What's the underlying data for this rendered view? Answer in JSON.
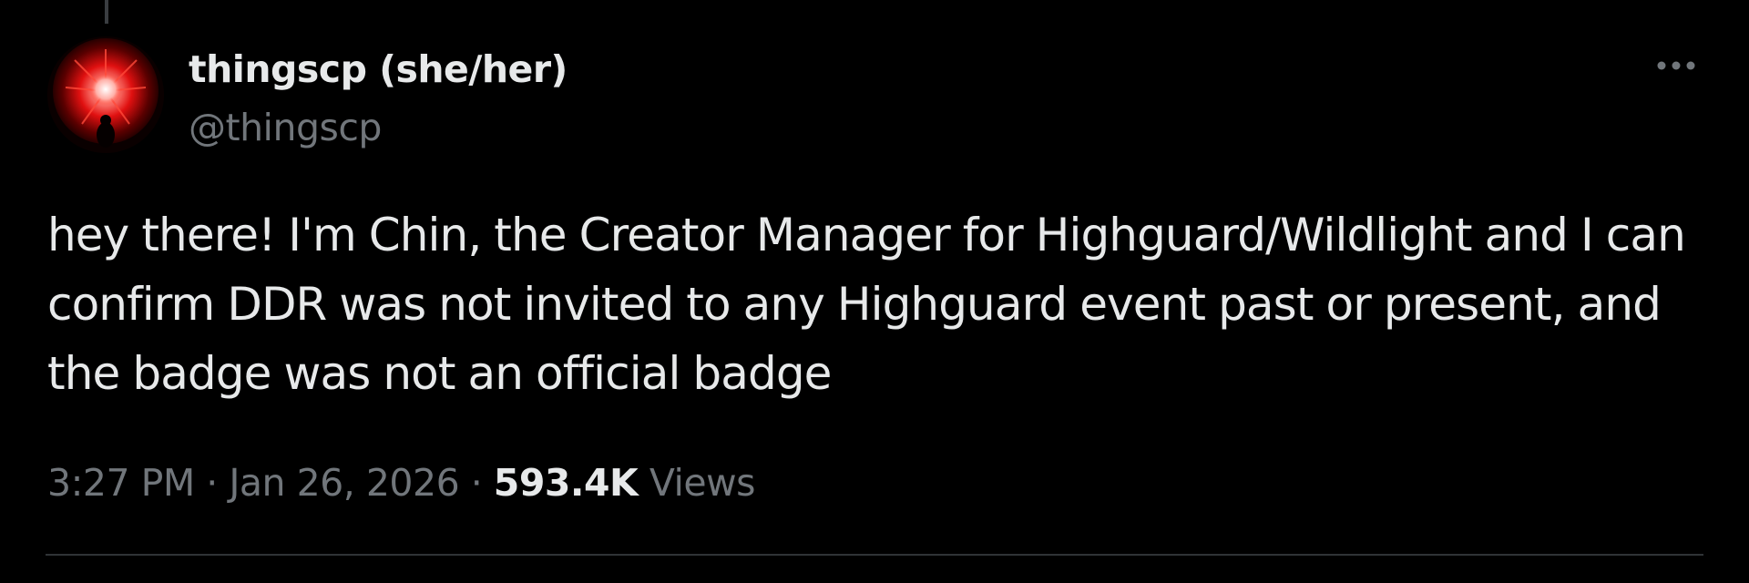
{
  "author": {
    "display_name": "thingscp (she/her)",
    "handle": "@thingscp",
    "avatar_icon": "red-burst-avatar"
  },
  "post": {
    "text_lines": [
      "hey there! I'm Chin, the Creator Manager for Highguard/Wildlight and I can",
      "confirm DDR was not invited to any Highguard event past or present, and",
      "the badge was not an official badge"
    ],
    "time": "3:27 PM",
    "separator": "·",
    "date": "Jan 26, 2026",
    "views_count": "593.4K",
    "views_label": "Views"
  },
  "menu": {
    "more_icon": "more-horizontal-icon"
  },
  "colors": {
    "background": "#000000",
    "primary_text": "#e7e9ea",
    "secondary_text": "#71767b",
    "divider": "#2f3336"
  }
}
